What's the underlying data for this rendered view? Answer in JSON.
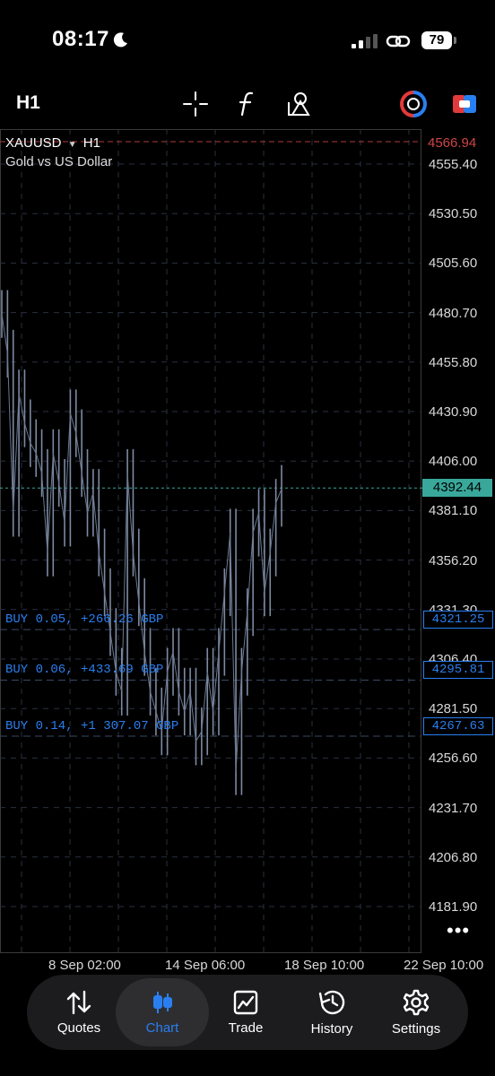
{
  "status_bar": {
    "time": "08:17",
    "battery": "79"
  },
  "toolbar": {
    "timeframe": "H1"
  },
  "chart": {
    "symbol": "XAUUSD",
    "symbol_timeframe": "H1",
    "description": "Gold vs US Dollar",
    "ask_price": "4566.94",
    "current_price": "4392.44",
    "price_axis": [
      "4555.40",
      "4530.50",
      "4505.60",
      "4480.70",
      "4455.80",
      "4430.90",
      "4406.00",
      "4381.10",
      "4356.20",
      "4331.30",
      "4306.40",
      "4281.50",
      "4256.60",
      "4231.70",
      "4206.80",
      "4181.90"
    ],
    "time_axis": [
      "8 Sep 02:00",
      "14 Sep 06:00",
      "18 Sep 10:00",
      "22 Sep 10:00"
    ],
    "positions": [
      {
        "label": "BUY 0.05, +266.26 GBP",
        "price": "4321.25"
      },
      {
        "label": "BUY 0.06, +433.69 GBP",
        "price": "4295.81"
      },
      {
        "label": "BUY 0.14, +1 307.07 GBP",
        "price": "4267.63"
      }
    ],
    "more": "•••"
  },
  "chart_data": {
    "type": "line",
    "title": "XAUUSD H1",
    "x": [
      "8 Sep 02:00",
      "14 Sep 06:00",
      "18 Sep 10:00",
      "22 Sep 10:00"
    ],
    "ylim": [
      4170,
      4570
    ],
    "series": [
      {
        "values": [
          4480,
          4460,
          4380,
          4440,
          4425,
          4415,
          4410,
          4400,
          4360,
          4410,
          4395,
          4375,
          4430,
          4420,
          4400,
          4380,
          4390,
          4360,
          4340,
          4320,
          4300,
          4290,
          4400,
          4360,
          4335,
          4310,
          4290,
          4280,
          4270,
          4300,
          4310,
          4290,
          4280,
          4290,
          4265,
          4270,
          4300,
          4280,
          4310,
          4340,
          4370,
          4250,
          4300,
          4330,
          4370,
          4380,
          4340,
          4360,
          4385,
          4392
        ]
      }
    ],
    "grid": true
  },
  "nav": {
    "items": [
      {
        "label": "Quotes"
      },
      {
        "label": "Chart"
      },
      {
        "label": "Trade"
      },
      {
        "label": "History"
      },
      {
        "label": "Settings"
      }
    ]
  }
}
